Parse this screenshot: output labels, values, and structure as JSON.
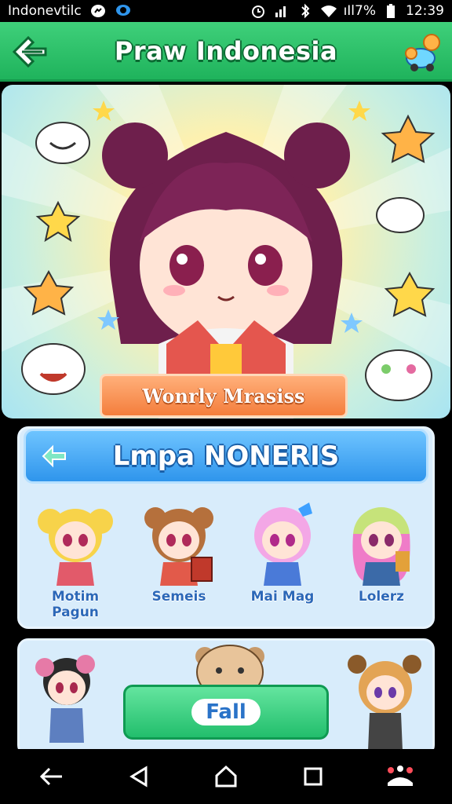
{
  "status_bar": {
    "carrier": "Indonevtilc",
    "battery_text": "ıIl7%",
    "time": "12:39",
    "icons": [
      "messenger-icon",
      "chat-bubble-icon",
      "alarm-icon",
      "signal-icon",
      "bluetooth-icon",
      "wifi-icon",
      "battery-icon"
    ]
  },
  "header": {
    "title": "Praw Indonesia",
    "back_icon": "back-arrow-icon",
    "mascot_icon": "mascot-icon"
  },
  "hero": {
    "caption": "Wonrly Mrasiss"
  },
  "panel": {
    "title": "Lmpa NONERIS",
    "characters": [
      {
        "name": "Motim Pagun"
      },
      {
        "name": "Semeis"
      },
      {
        "name": "Mai Mag"
      },
      {
        "name": "Lolerz"
      }
    ]
  },
  "bottom": {
    "play_label": "Fall"
  },
  "nav": {
    "items": [
      "back-nav-icon",
      "triangle-back-icon",
      "home-icon",
      "recents-icon",
      "menu-icon"
    ]
  },
  "colors": {
    "header_green": "#1fb35c",
    "panel_blue": "#2f95ec",
    "caption_orange": "#f47e3c",
    "play_green": "#22be6c"
  }
}
